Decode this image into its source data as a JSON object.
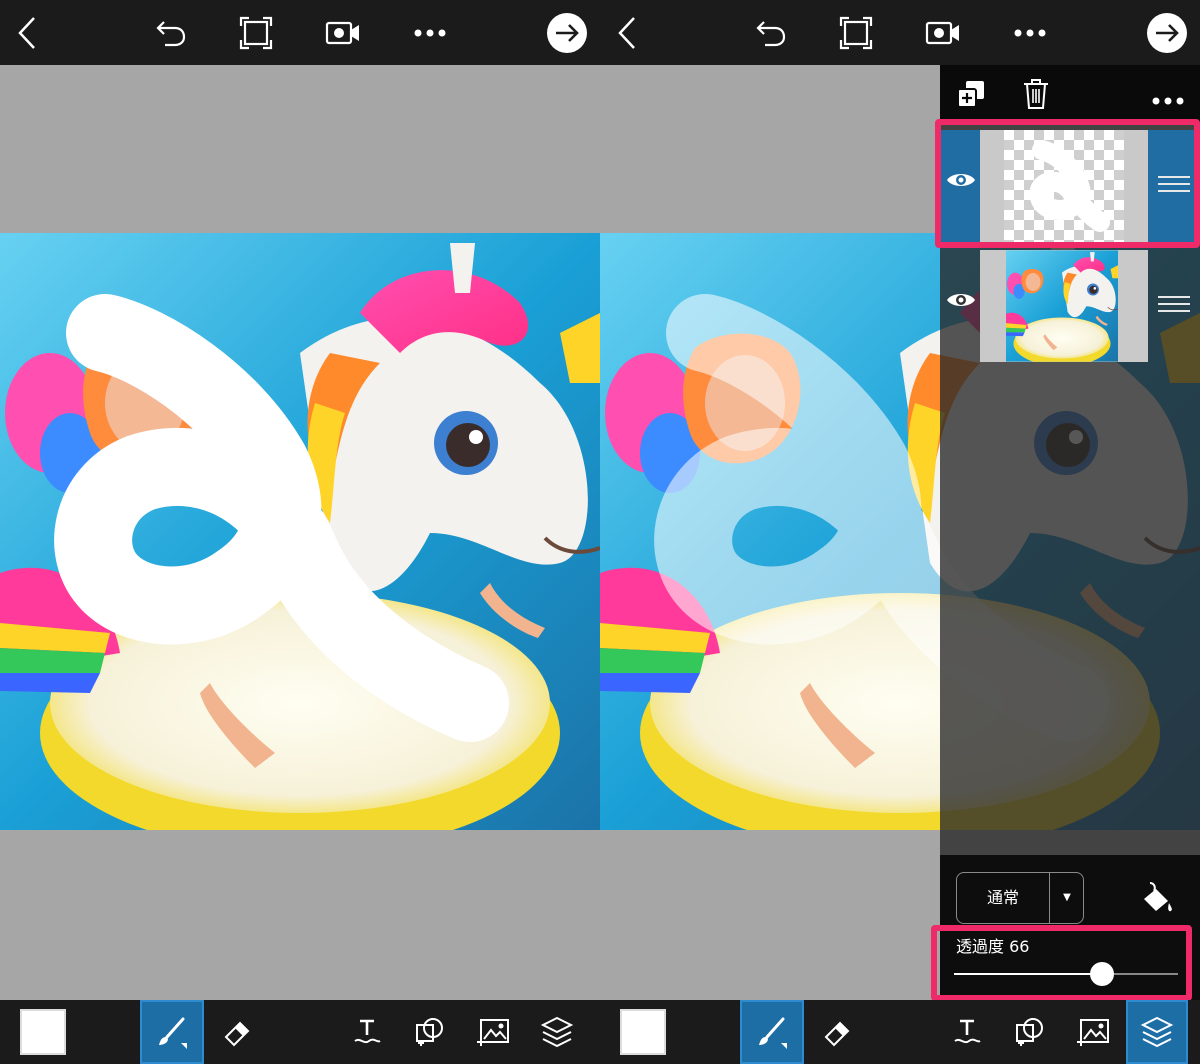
{
  "toolbar": {
    "back_icon": "chevron-left-icon",
    "undo_icon": "undo-icon",
    "crop_icon": "crop-frame-icon",
    "record_icon": "video-record-icon",
    "more_icon": "more-dots-icon",
    "next_icon": "arrow-right-circle-icon"
  },
  "bottom_tools": {
    "items": [
      {
        "icon": "color-swatch-icon",
        "selected": false
      },
      {
        "icon": "brush-icon",
        "selected": true
      },
      {
        "icon": "eraser-icon",
        "selected": false
      },
      {
        "icon": "text-icon",
        "selected": false
      },
      {
        "icon": "shape-icon",
        "selected": false
      },
      {
        "icon": "image-add-icon",
        "selected": false
      },
      {
        "icon": "layers-icon",
        "selected": false
      }
    ],
    "color_swatch": "#ffffff"
  },
  "bottom_tools_right": {
    "layers_selected": true
  },
  "layers_panel": {
    "head_icons": [
      "add-layer-icon",
      "trash-icon",
      "more-dots-icon"
    ],
    "layers": [
      {
        "name": "drawing-layer",
        "visible": true,
        "selected": true
      },
      {
        "name": "photo-layer",
        "visible": true,
        "selected": false
      }
    ],
    "blend_mode": "通常",
    "blend_dropdown": "▼",
    "fill_icon": "paint-bucket-icon",
    "opacity_label": "透過度 66",
    "opacity_value": 66
  },
  "colors": {
    "accent_blue": "#1f6da3",
    "highlight_pink": "#ee2a68",
    "toolbar_bg": "#1b1b1b",
    "canvas_bg": "#a6a6a6"
  }
}
